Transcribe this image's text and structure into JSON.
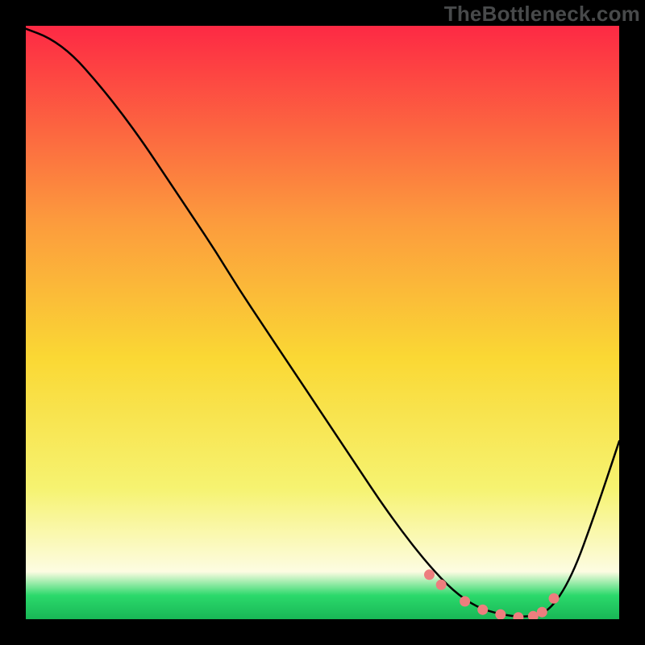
{
  "watermark": "TheBottleneck.com",
  "colors": {
    "frame": "#000000",
    "curve_stroke": "#000000",
    "marker_fill": "#ed7e7e",
    "gradient_top": "#fd2944",
    "gradient_mid_upper": "#fc9b3d",
    "gradient_mid": "#fad834",
    "gradient_mid_lower": "#f6f371",
    "gradient_light": "#fdfce2",
    "gradient_green": "#2bd96b",
    "gradient_bottom": "#18b756"
  },
  "chart_data": {
    "type": "line",
    "x": [
      0.0,
      0.04,
      0.08,
      0.12,
      0.16,
      0.2,
      0.24,
      0.28,
      0.32,
      0.36,
      0.4,
      0.44,
      0.48,
      0.52,
      0.56,
      0.6,
      0.64,
      0.68,
      0.72,
      0.76,
      0.8,
      0.84,
      0.88,
      0.92,
      0.96,
      1.0
    ],
    "values": [
      0.995,
      0.98,
      0.95,
      0.905,
      0.855,
      0.8,
      0.74,
      0.68,
      0.62,
      0.555,
      0.495,
      0.435,
      0.375,
      0.315,
      0.255,
      0.195,
      0.14,
      0.09,
      0.048,
      0.02,
      0.008,
      0.003,
      0.01,
      0.07,
      0.18,
      0.3
    ],
    "markers_x": [
      0.68,
      0.7,
      0.74,
      0.77,
      0.8,
      0.83,
      0.855,
      0.87,
      0.89
    ],
    "markers_y": [
      0.075,
      0.058,
      0.03,
      0.016,
      0.008,
      0.003,
      0.005,
      0.012,
      0.035
    ],
    "xlim": [
      0,
      1
    ],
    "ylim": [
      0,
      1
    ],
    "title": "",
    "xlabel": "",
    "ylabel": ""
  }
}
